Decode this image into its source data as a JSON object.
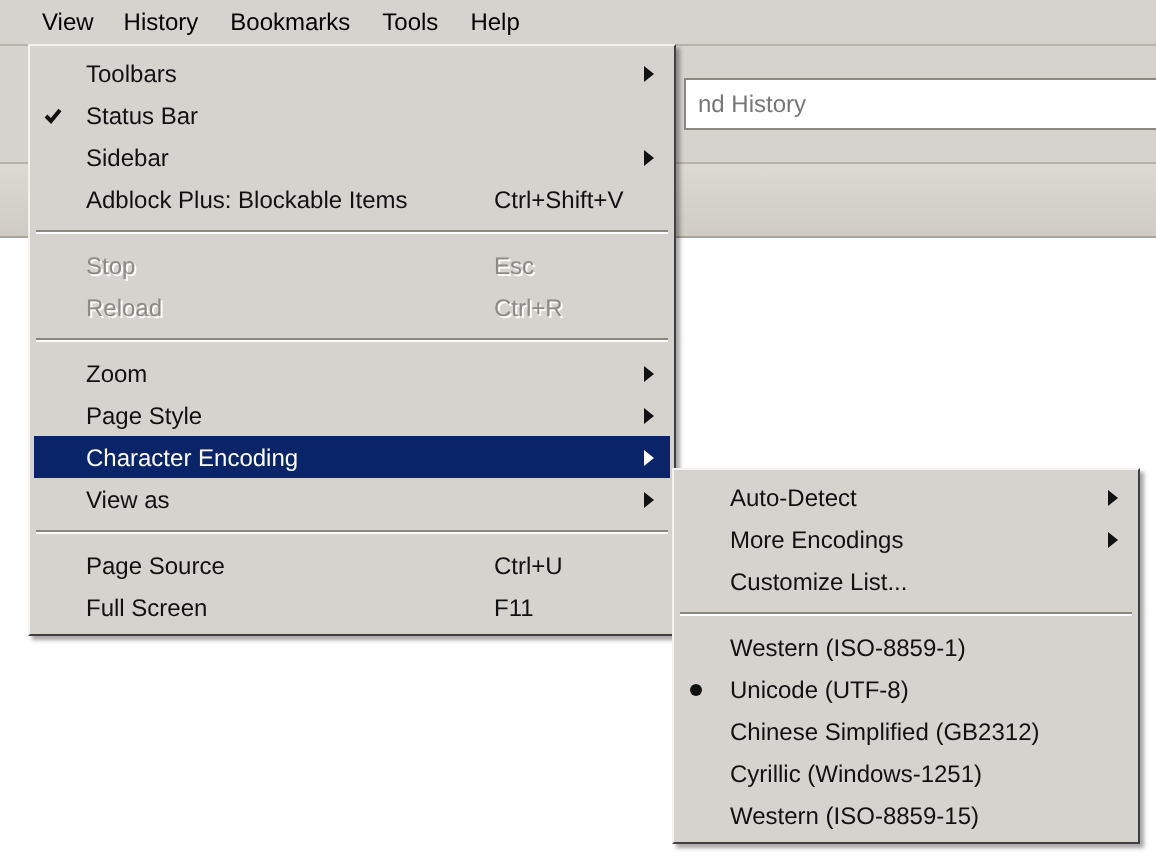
{
  "menubar": [
    {
      "label": "View",
      "open": true
    },
    {
      "label": "History",
      "open": false
    },
    {
      "label": "Bookmarks",
      "open": false
    },
    {
      "label": "Tools",
      "open": false
    },
    {
      "label": "Help",
      "open": false
    }
  ],
  "search": {
    "placeholder": "nd History"
  },
  "view_menu": {
    "sections": [
      [
        {
          "label": "Toolbars",
          "submenu": true,
          "checked": false,
          "disabled": false,
          "selected": false
        },
        {
          "label": "Status Bar",
          "submenu": false,
          "checked": true,
          "disabled": false,
          "selected": false
        },
        {
          "label": "Sidebar",
          "submenu": true,
          "checked": false,
          "disabled": false,
          "selected": false
        },
        {
          "label": "Adblock Plus: Blockable Items",
          "shortcut": "Ctrl+Shift+V",
          "submenu": false,
          "checked": false,
          "disabled": false,
          "selected": false
        }
      ],
      [
        {
          "label": "Stop",
          "shortcut": "Esc",
          "submenu": false,
          "checked": false,
          "disabled": true,
          "selected": false
        },
        {
          "label": "Reload",
          "shortcut": "Ctrl+R",
          "submenu": false,
          "checked": false,
          "disabled": true,
          "selected": false
        }
      ],
      [
        {
          "label": "Zoom",
          "submenu": true,
          "checked": false,
          "disabled": false,
          "selected": false
        },
        {
          "label": "Page Style",
          "submenu": true,
          "checked": false,
          "disabled": false,
          "selected": false
        },
        {
          "label": "Character Encoding",
          "submenu": true,
          "checked": false,
          "disabled": false,
          "selected": true
        },
        {
          "label": "View as",
          "submenu": true,
          "checked": false,
          "disabled": false,
          "selected": false
        }
      ],
      [
        {
          "label": "Page Source",
          "shortcut": "Ctrl+U",
          "submenu": false,
          "checked": false,
          "disabled": false,
          "selected": false
        },
        {
          "label": "Full Screen",
          "shortcut": "F11",
          "submenu": false,
          "checked": false,
          "disabled": false,
          "selected": false
        }
      ]
    ]
  },
  "encoding_menu": {
    "sections": [
      [
        {
          "label": "Auto-Detect",
          "submenu": true,
          "checked": false
        },
        {
          "label": "More Encodings",
          "submenu": true,
          "checked": false
        },
        {
          "label": "Customize List...",
          "submenu": false,
          "checked": false
        }
      ],
      [
        {
          "label": "Western (ISO-8859-1)",
          "submenu": false,
          "checked": false
        },
        {
          "label": "Unicode (UTF-8)",
          "submenu": false,
          "checked": true
        },
        {
          "label": "Chinese Simplified (GB2312)",
          "submenu": false,
          "checked": false
        },
        {
          "label": "Cyrillic (Windows-1251)",
          "submenu": false,
          "checked": false
        },
        {
          "label": "Western (ISO-8859-15)",
          "submenu": false,
          "checked": false
        }
      ]
    ]
  }
}
